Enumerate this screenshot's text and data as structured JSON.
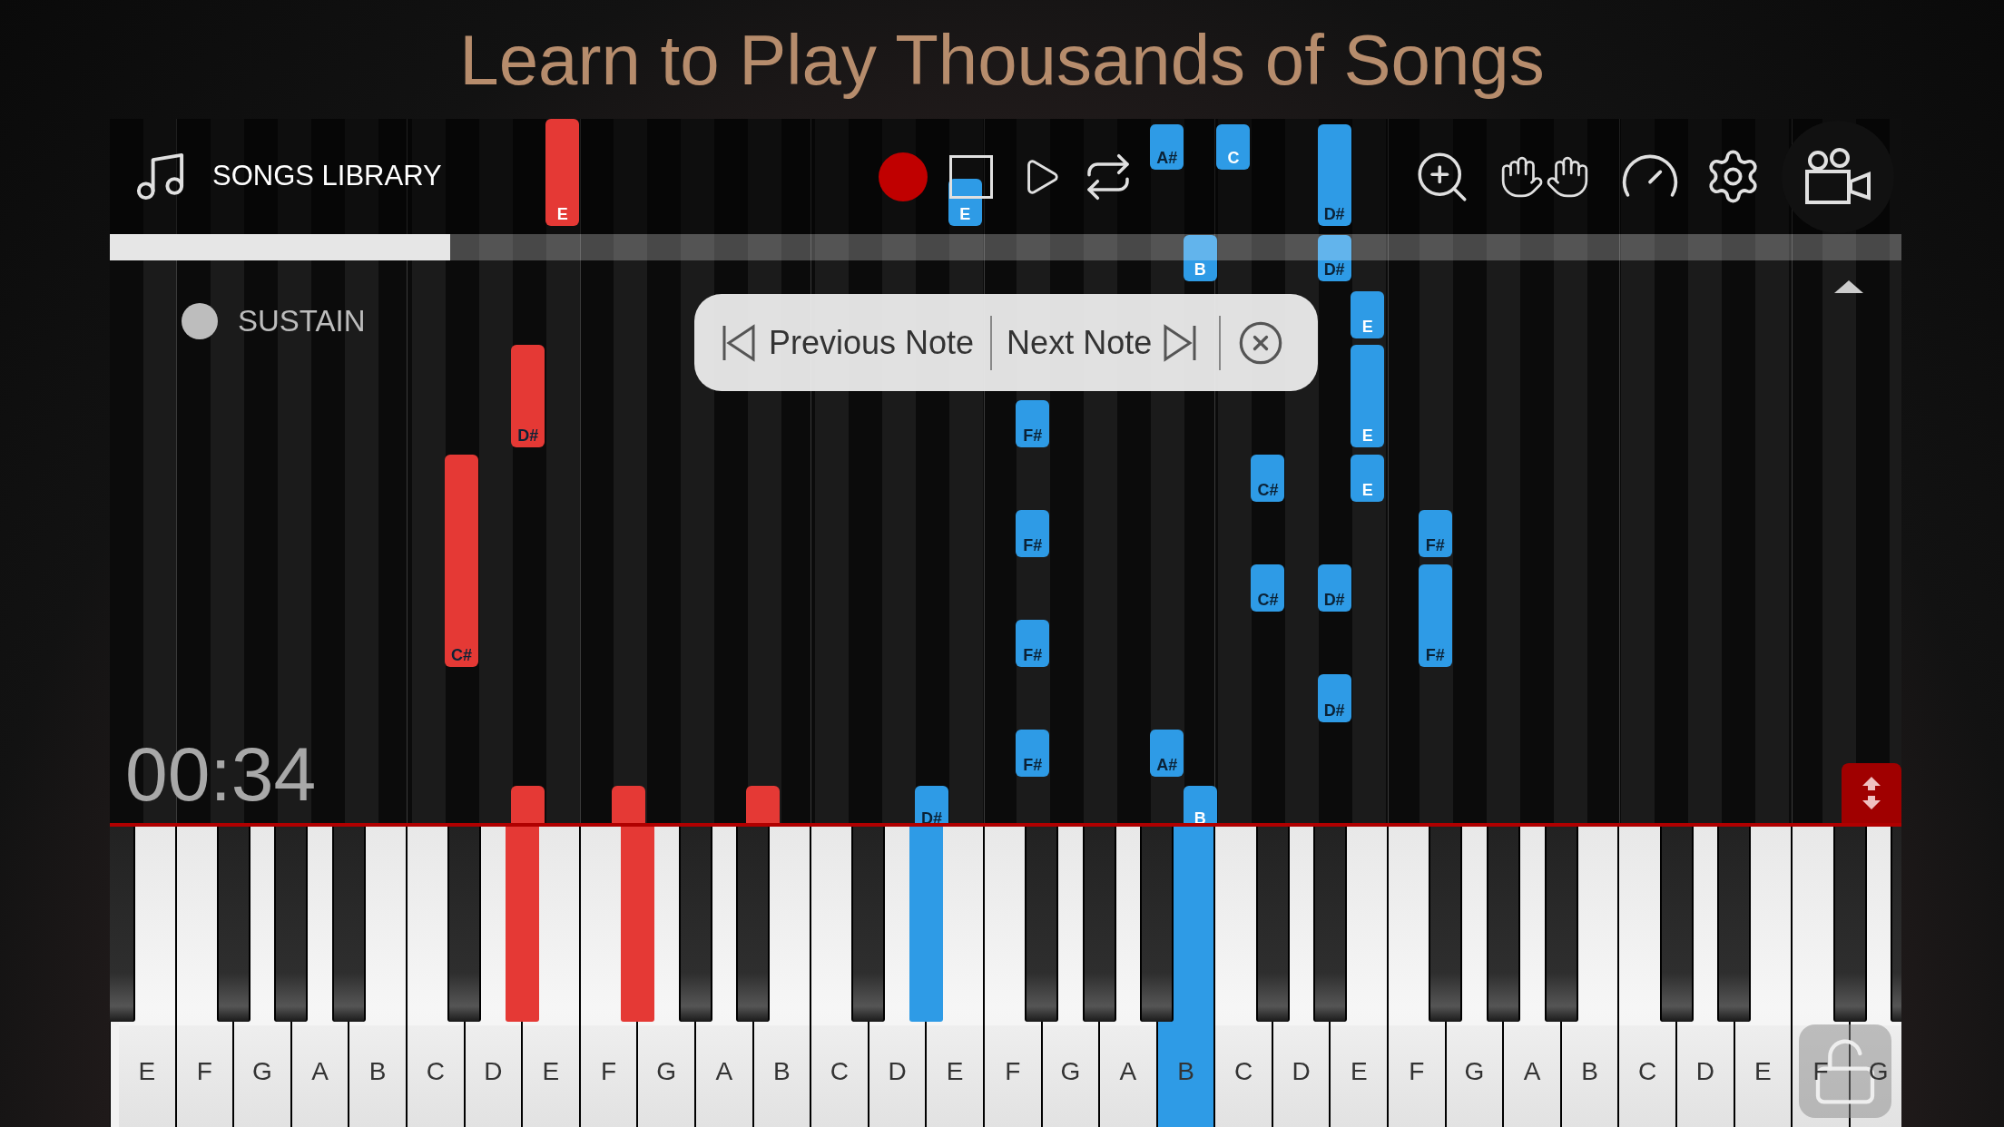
{
  "title": "Learn to Play Thousands of Songs",
  "toolbar": {
    "library_label": "SONGS LIBRARY"
  },
  "progress": {
    "level": 0.19
  },
  "sustain": {
    "label": "SUSTAIN",
    "on": false
  },
  "navigator": {
    "previous": "Previous Note",
    "next": "Next Note"
  },
  "timer": "00:34",
  "notes": [
    {
      "label": "A#",
      "color": "#2e9be6",
      "kind": "sharp"
    },
    {
      "label": "C",
      "color": "#2e9be6",
      "kind": "natural"
    },
    {
      "label": "E",
      "color": "#e53935",
      "kind": "natural"
    },
    {
      "label": "E",
      "color": "#2e9be6",
      "kind": "natural"
    },
    {
      "label": "D#",
      "color": "#2e9be6",
      "kind": "sharp"
    },
    {
      "label": "B",
      "color": "#2e9be6",
      "kind": "natural"
    },
    {
      "label": "D#",
      "color": "#2e9be6",
      "kind": "sharp"
    },
    {
      "label": "E",
      "color": "#2e9be6",
      "kind": "natural"
    },
    {
      "label": "D#",
      "color": "#e53935",
      "kind": "sharp"
    },
    {
      "label": "F#",
      "color": "#2e9be6",
      "kind": "sharp"
    },
    {
      "label": "E",
      "color": "#2e9be6",
      "kind": "natural"
    },
    {
      "label": "C#",
      "color": "#2e9be6",
      "kind": "sharp"
    },
    {
      "label": "E",
      "color": "#2e9be6",
      "kind": "natural"
    },
    {
      "label": "F#",
      "color": "#2e9be6",
      "kind": "sharp"
    },
    {
      "label": "F#",
      "color": "#2e9be6",
      "kind": "sharp"
    },
    {
      "label": "C#",
      "color": "#2e9be6",
      "kind": "sharp"
    },
    {
      "label": "D#",
      "color": "#2e9be6",
      "kind": "sharp"
    },
    {
      "label": "C#",
      "color": "#e53935",
      "kind": "sharp"
    },
    {
      "label": "F#",
      "color": "#2e9be6",
      "kind": "sharp"
    },
    {
      "label": "F#",
      "color": "#2e9be6",
      "kind": "sharp"
    },
    {
      "label": "D#",
      "color": "#2e9be6",
      "kind": "sharp"
    },
    {
      "label": "F#",
      "color": "#2e9be6",
      "kind": "sharp"
    },
    {
      "label": "A#",
      "color": "#2e9be6",
      "kind": "sharp"
    },
    {
      "color": "#e53935",
      "kind": "sharp"
    },
    {
      "color": "#e53935",
      "kind": "sharp"
    },
    {
      "color": "#e53935",
      "kind": "sharp"
    },
    {
      "label": "D#",
      "color": "#2e9be6",
      "kind": "sharp"
    },
    {
      "label": "B",
      "color": "#2e9be6",
      "kind": "natural"
    }
  ],
  "keyboard": {
    "white_keys": [
      {
        "label": "E",
        "pressed": false
      },
      {
        "label": "F",
        "pressed": false
      },
      {
        "label": "G",
        "pressed": false
      },
      {
        "label": "A",
        "pressed": false
      },
      {
        "label": "B",
        "pressed": false
      },
      {
        "label": "C",
        "pressed": false
      },
      {
        "label": "D",
        "pressed": false
      },
      {
        "label": "E",
        "pressed": false
      },
      {
        "label": "F",
        "pressed": false
      },
      {
        "label": "G",
        "pressed": false
      },
      {
        "label": "A",
        "pressed": false
      },
      {
        "label": "B",
        "pressed": false
      },
      {
        "label": "C",
        "pressed": false
      },
      {
        "label": "D",
        "pressed": false
      },
      {
        "label": "E",
        "pressed": false
      },
      {
        "label": "F",
        "pressed": false
      },
      {
        "label": "G",
        "pressed": false
      },
      {
        "label": "A",
        "pressed": false
      },
      {
        "label": "B",
        "pressed": true,
        "color": "#2e9be6"
      },
      {
        "label": "C",
        "pressed": false
      },
      {
        "label": "D",
        "pressed": false
      },
      {
        "label": "E",
        "pressed": false
      },
      {
        "label": "F",
        "pressed": false
      },
      {
        "label": "G",
        "pressed": false
      },
      {
        "label": "A",
        "pressed": false
      },
      {
        "label": "B",
        "pressed": false
      },
      {
        "label": "C",
        "pressed": false
      },
      {
        "label": "D",
        "pressed": false
      },
      {
        "label": "E",
        "pressed": false
      },
      {
        "label": "F",
        "pressed": false
      },
      {
        "label": "G",
        "pressed": false
      }
    ],
    "black_keys": [
      {
        "pressed": false
      },
      {
        "pressed": false
      },
      {
        "pressed": false
      },
      {
        "pressed": false
      },
      {
        "pressed": false
      },
      {
        "pressed": true,
        "color": "#e53935"
      },
      {
        "pressed": true,
        "color": "#e53935"
      },
      {
        "pressed": false
      },
      {
        "pressed": false
      },
      {
        "pressed": false
      },
      {
        "pressed": true,
        "color": "#2e9be6"
      },
      {
        "pressed": false
      },
      {
        "pressed": false
      },
      {
        "pressed": false
      },
      {
        "pressed": false
      },
      {
        "pressed": false
      },
      {
        "pressed": false
      },
      {
        "pressed": false
      },
      {
        "pressed": false
      },
      {
        "pressed": false
      },
      {
        "pressed": false
      },
      {
        "pressed": false
      },
      {
        "pressed": false
      }
    ]
  }
}
